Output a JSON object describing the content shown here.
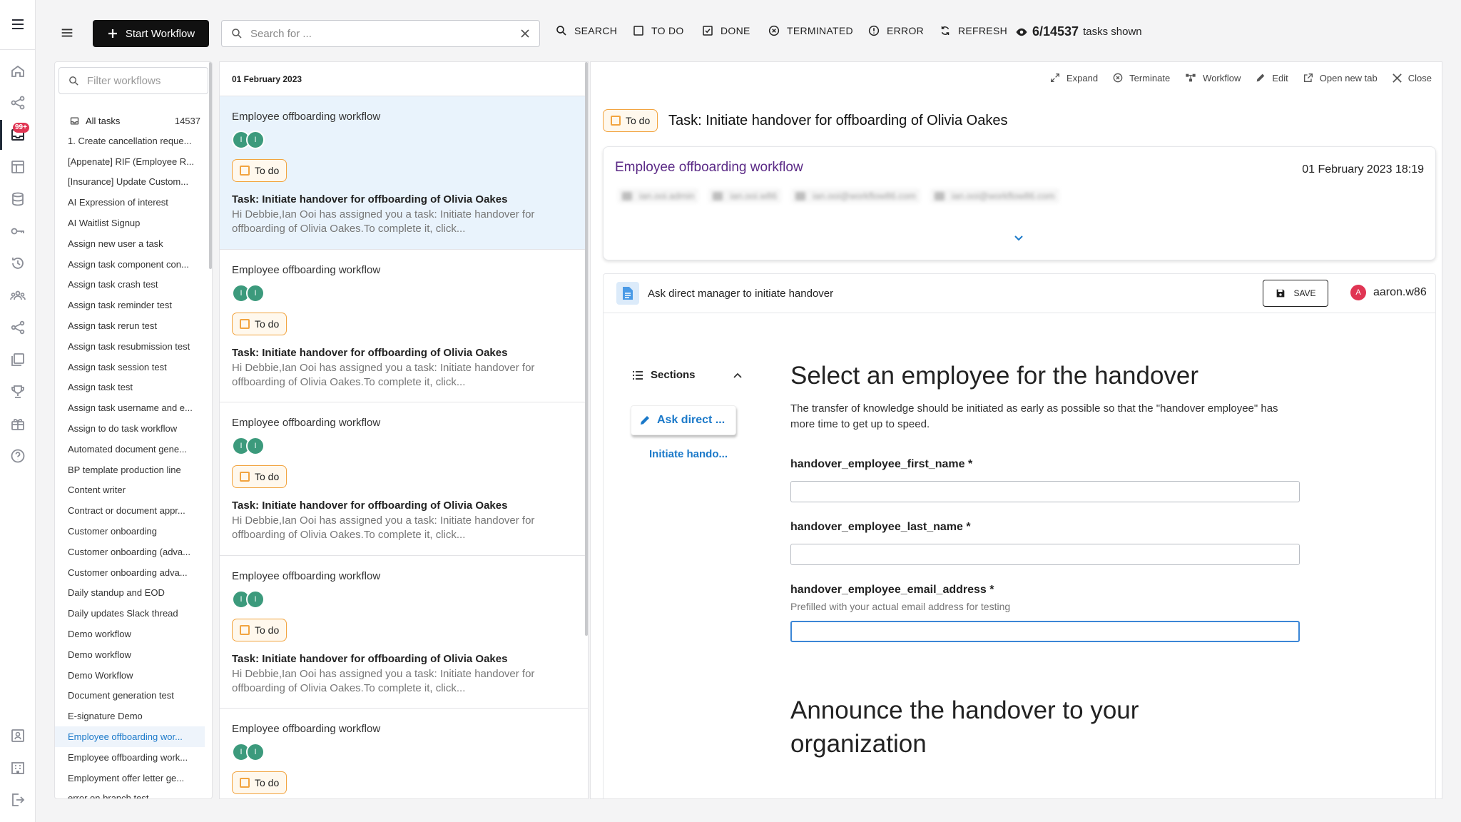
{
  "topbar": {
    "start_workflow": "Start Workflow",
    "search_placeholder": "Search for ...",
    "filters": {
      "search": "SEARCH",
      "todo": "TO DO",
      "done": "DONE",
      "terminated": "TERMINATED",
      "error": "ERROR",
      "refresh": "REFRESH"
    },
    "shown_count": "6/14537",
    "shown_suffix": "tasks shown"
  },
  "rail": {
    "badge": "99+",
    "icons": [
      "menu-icon",
      "home-icon",
      "workflow-icon",
      "inbox-icon",
      "table-icon",
      "database-icon",
      "key-icon",
      "history-icon",
      "team-icon",
      "share-icon",
      "library-icon",
      "trophy-icon",
      "gift-icon",
      "help-icon",
      "profile-icon",
      "building-icon",
      "logout-icon"
    ]
  },
  "workflows": {
    "filter_placeholder": "Filter workflows",
    "all_label": "All tasks",
    "all_count": "14537",
    "items": [
      "1. Create cancellation reque...",
      "[Appenate] RIF (Employee R...",
      "[Insurance] Update Custom...",
      "AI Expression of interest",
      "AI Waitlist Signup",
      "Assign new user a task",
      "Assign task component con...",
      "Assign task crash test",
      "Assign task reminder test",
      "Assign task rerun test",
      "Assign task resubmission test",
      "Assign task session test",
      "Assign task test",
      "Assign task username and e...",
      "Assign to do task workflow",
      "Automated document gene...",
      "BP template production line",
      "Content writer",
      "Contract or document appr...",
      "Customer onboarding",
      "Customer onboarding (adva...",
      "Customer onboarding adva...",
      "Daily standup and EOD",
      "Daily updates Slack thread",
      "Demo workflow",
      "Demo workflow",
      "Demo Workflow",
      "Document generation test",
      "E-signature Demo",
      "Employee offboarding wor...",
      "Employee offboarding work...",
      "Employment offer letter ge...",
      "error on branch test"
    ],
    "selected_index": 29
  },
  "tasklist": {
    "date": "01 February 2023",
    "tasks": [
      {
        "workflow": "Employee offboarding workflow",
        "avatars": [
          "I",
          "I"
        ],
        "status": "To do",
        "title": "Task: Initiate handover for offboarding of Olivia Oakes",
        "body": "Hi Debbie,Ian Ooi has assigned you a task: Initiate handover for offboarding of Olivia Oakes.To complete it, click..."
      },
      {
        "workflow": "Employee offboarding workflow",
        "avatars": [
          "I",
          "I"
        ],
        "status": "To do",
        "title": "Task: Initiate handover for offboarding of Olivia Oakes",
        "body": "Hi Debbie,Ian Ooi has assigned you a task: Initiate handover for offboarding of Olivia Oakes.To complete it, click..."
      },
      {
        "workflow": "Employee offboarding workflow",
        "avatars": [
          "I",
          "I"
        ],
        "status": "To do",
        "title": "Task: Initiate handover for offboarding of Olivia Oakes",
        "body": "Hi Debbie,Ian Ooi has assigned you a task: Initiate handover for offboarding of Olivia Oakes.To complete it, click..."
      },
      {
        "workflow": "Employee offboarding workflow",
        "avatars": [
          "I",
          "I"
        ],
        "status": "To do",
        "title": "Task: Initiate handover for offboarding of Olivia Oakes",
        "body": "Hi Debbie,Ian Ooi has assigned you a task: Initiate handover for offboarding of Olivia Oakes.To complete it, click..."
      },
      {
        "workflow": "Employee offboarding workflow",
        "avatars": [
          "I",
          "I"
        ],
        "status": "To do",
        "title": "",
        "body": ""
      }
    ]
  },
  "detail": {
    "actions": {
      "expand": "Expand",
      "terminate": "Terminate",
      "workflow": "Workflow",
      "edit": "Edit",
      "open_new_tab": "Open new tab",
      "close": "Close"
    },
    "status": "To do",
    "title": "Task: Initiate handover for offboarding of Olivia Oakes",
    "workflow_name": "Employee offboarding workflow",
    "workflow_date": "01 February 2023 18:19",
    "meta_blurred": [
      "ian.ooi.admin",
      "ian.ooi.w86",
      "ian.ooi@workflow86.com",
      "ian.ooi@workflow86.com"
    ],
    "step": {
      "name": "Ask direct manager to initiate handover",
      "save": "SAVE",
      "user_initial": "A",
      "user": "aaron.w86"
    },
    "sections": {
      "label": "Sections",
      "active": "Ask direct ...",
      "link": "Initiate hando..."
    },
    "form": {
      "heading": "Select an employee for the handover",
      "intro": "The transfer of knowledge should be initiated as early as possible so that the \"handover employee\" has more time to get up to speed.",
      "fields": [
        {
          "label": "handover_employee_first_name *",
          "help": "",
          "value": ""
        },
        {
          "label": "handover_employee_last_name *",
          "help": "",
          "value": ""
        },
        {
          "label": "handover_employee_email_address *",
          "help": "Prefilled with your actual email address for testing",
          "value": ""
        }
      ],
      "heading2": "Announce the handover to your organization"
    }
  },
  "colors": {
    "accent_blue": "#1b79c9",
    "todo_orange": "#f2a440",
    "badge_red": "#e03553",
    "workflow_purple": "#5b2a86",
    "avatar_green": "#3c9a7c"
  }
}
